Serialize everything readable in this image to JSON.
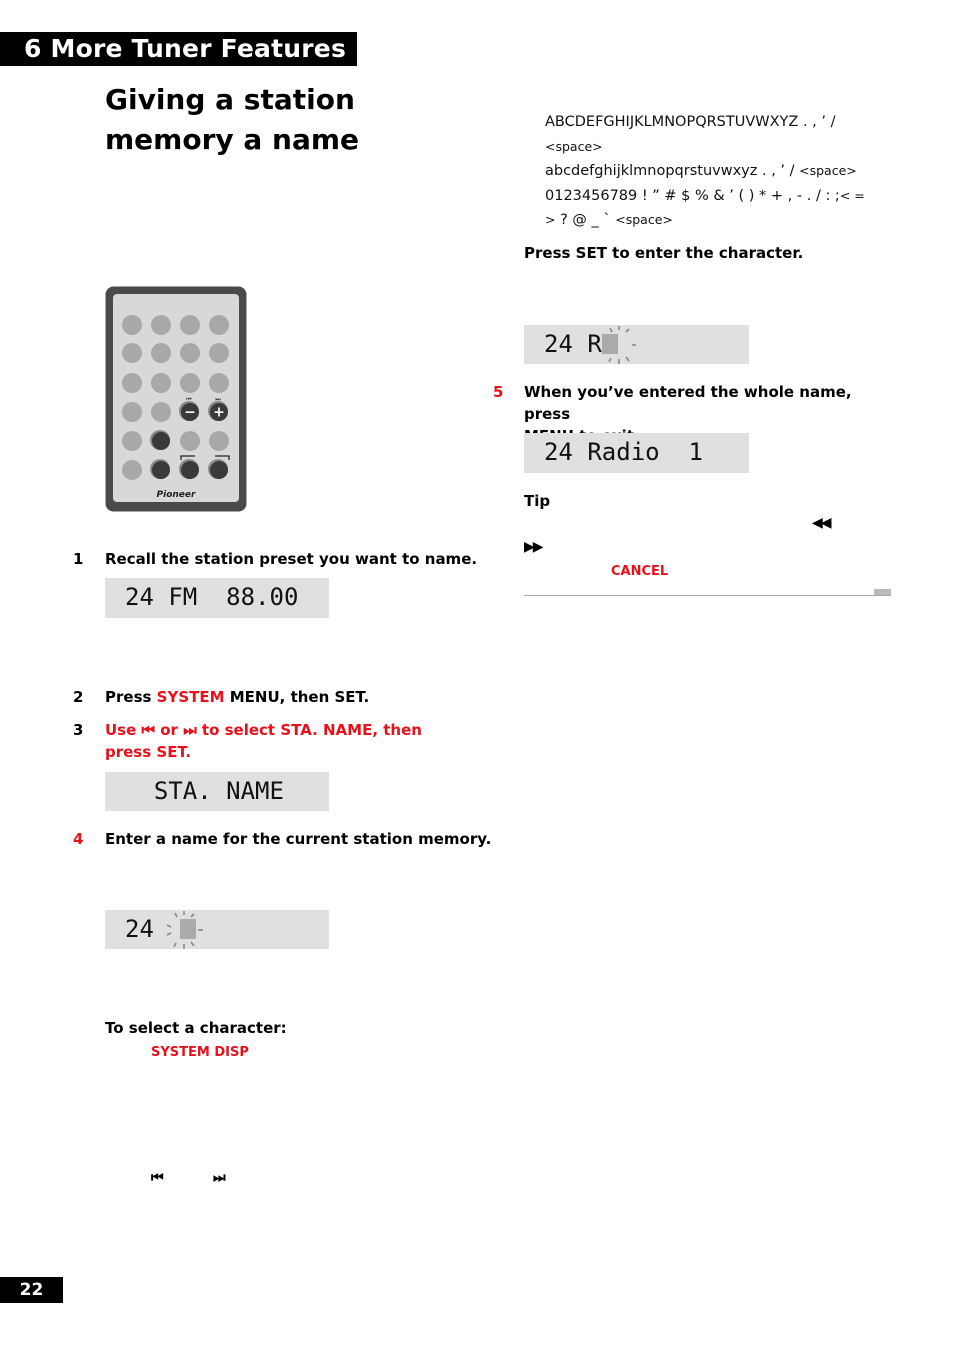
{
  "header": {
    "chapter_label": "6  More Tuner Features"
  },
  "page_title": "Giving a station memory a name",
  "character_sets": {
    "uppercase": "ABCDEFGHIJKLMNOPQRSTUVWXYZ . , ’ /",
    "uppercase_space": "<space>",
    "lowercase": "abcdefghijklmnopqrstuvwxyz . , ’ /",
    "lowercase_space": "<space>",
    "symbols_line1": "0123456789 ! ” # $ % & ’ ( ) * + , - . / : ;",
    "symbols_line1_end": "< =",
    "symbols_line2_start": ">",
    "symbols_line2": "? @ _ `",
    "symbols_space": "<space>"
  },
  "press_set_text": "Press SET to enter the character.",
  "steps": [
    {
      "number": "1",
      "text": "Recall the station preset you want to name.",
      "display": "24 FM  88.00"
    },
    {
      "number": "2",
      "pre": "Press ",
      "highlight": "SYSTEM",
      "post": " MENU, then SET."
    },
    {
      "number": "3",
      "line1_a": "Use ",
      "line1_b": " or ",
      "line1_c": " to select STA. NAME, then",
      "line2": "press SET.",
      "display": "  STA. NAME"
    },
    {
      "number": "4",
      "text": "Enter a name for the current station memory.",
      "display": "24 "
    },
    {
      "number": "5",
      "line1": "When you’ve entered the whole name, press",
      "line2": "MENU to exit.",
      "display": "24 Radio  1"
    }
  ],
  "entry_display": "24 R",
  "select_character": {
    "heading": "To select a character:",
    "system_disp_label": "SYSTEM DISP",
    "prev_icon": "⏮",
    "next_icon": "⏭"
  },
  "tip": {
    "heading": "Tip",
    "rewind_icon": "◀◀",
    "forward_icon": "▶▶",
    "cancel_label": "CANCEL"
  },
  "remote": {
    "brand": "Pioneer",
    "minus_label": "−",
    "plus_label": "+",
    "prev_mini": "⏮",
    "next_mini": "⏭"
  },
  "page_number": "22",
  "colors": {
    "accent_red": "#e8101a",
    "lcd_background": "#e0e0e0"
  }
}
